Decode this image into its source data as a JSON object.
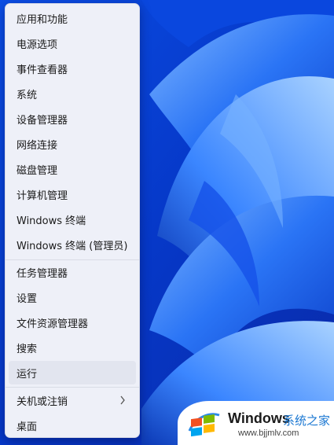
{
  "menu": {
    "items": [
      {
        "label": "应用和功能"
      },
      {
        "label": "电源选项"
      },
      {
        "label": "事件查看器"
      },
      {
        "label": "系统"
      },
      {
        "label": "设备管理器"
      },
      {
        "label": "网络连接"
      },
      {
        "label": "磁盘管理"
      },
      {
        "label": "计算机管理"
      },
      {
        "label": "Windows 终端"
      },
      {
        "label": "Windows 终端 (管理员)"
      },
      {
        "label": "任务管理器"
      },
      {
        "label": "设置"
      },
      {
        "label": "文件资源管理器"
      },
      {
        "label": "搜索"
      },
      {
        "label": "运行"
      },
      {
        "label": "关机或注销",
        "submenu_icon": "chevron-right-icon"
      },
      {
        "label": "桌面"
      }
    ]
  },
  "watermark": {
    "brand": "Windows",
    "brand_cn": "系统之家",
    "url": "www.bjjmlv.com"
  },
  "colors": {
    "wallpaper_blue": "#0a3fd6",
    "menu_background": "#eef0f8",
    "hover": "#e2e5ef"
  }
}
